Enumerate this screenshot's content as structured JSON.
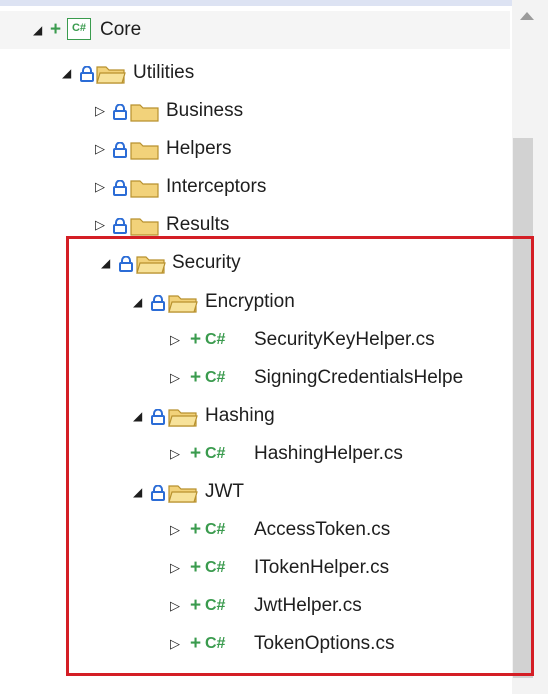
{
  "tree": {
    "items": [
      {
        "label": "Core",
        "icon": "csharp-project-icon",
        "expand": "expanded",
        "badge": "+",
        "project_badge": "C#"
      },
      {
        "label": "Utilities",
        "icon": "folder-open-icon",
        "expand": "expanded"
      },
      {
        "label": "Business",
        "icon": "folder-icon",
        "expand": "collapsed"
      },
      {
        "label": "Helpers",
        "icon": "folder-icon",
        "expand": "collapsed"
      },
      {
        "label": "Interceptors",
        "icon": "folder-icon",
        "expand": "collapsed"
      },
      {
        "label": "Results",
        "icon": "folder-icon",
        "expand": "collapsed"
      },
      {
        "label": "Security",
        "icon": "folder-open-icon",
        "expand": "expanded"
      },
      {
        "label": "Encryption",
        "icon": "folder-open-icon",
        "expand": "expanded"
      },
      {
        "label": "SecurityKeyHelper.cs",
        "icon": "csharp-file-icon",
        "expand": "collapsed",
        "badge": "+",
        "file_badge": "C#"
      },
      {
        "label": "SigningCredentialsHelpe",
        "icon": "csharp-file-icon",
        "expand": "collapsed",
        "badge": "+",
        "file_badge": "C#"
      },
      {
        "label": "Hashing",
        "icon": "folder-open-icon",
        "expand": "expanded"
      },
      {
        "label": "HashingHelper.cs",
        "icon": "csharp-file-icon",
        "expand": "collapsed",
        "badge": "+",
        "file_badge": "C#"
      },
      {
        "label": "JWT",
        "icon": "folder-open-icon",
        "expand": "expanded"
      },
      {
        "label": "AccessToken.cs",
        "icon": "csharp-file-icon",
        "expand": "collapsed",
        "badge": "+",
        "file_badge": "C#"
      },
      {
        "label": "ITokenHelper.cs",
        "icon": "csharp-file-icon",
        "expand": "collapsed",
        "badge": "+",
        "file_badge": "C#"
      },
      {
        "label": "JwtHelper.cs",
        "icon": "csharp-file-icon",
        "expand": "collapsed",
        "badge": "+",
        "file_badge": "C#"
      },
      {
        "label": "TokenOptions.cs",
        "icon": "csharp-file-icon",
        "expand": "collapsed",
        "badge": "+",
        "file_badge": "C#"
      }
    ]
  },
  "colors": {
    "add_badge": "#3a9b4e",
    "lock": "#2b6cd6",
    "folder_fill": "#f2d27a",
    "folder_stroke": "#b8912e",
    "highlight_box": "#d41e25",
    "scrollbar_track": "#f3f3f3",
    "scrollbar_thumb": "#d2d2d2"
  },
  "glyphs": {
    "expanded": "◢",
    "collapsed": "▷"
  }
}
